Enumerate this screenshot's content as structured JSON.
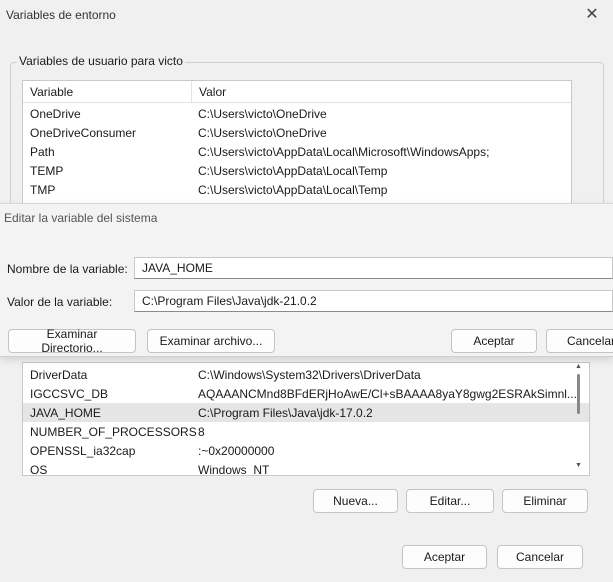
{
  "window": {
    "title": "Variables de entorno",
    "close_glyph": "✕"
  },
  "user_group": {
    "label": "Variables de usuario para victo",
    "columns": [
      "Variable",
      "Valor"
    ],
    "rows": [
      [
        "OneDrive",
        "C:\\Users\\victo\\OneDrive"
      ],
      [
        "OneDriveConsumer",
        "C:\\Users\\victo\\OneDrive"
      ],
      [
        "Path",
        "C:\\Users\\victo\\AppData\\Local\\Microsoft\\WindowsApps;"
      ],
      [
        "TEMP",
        "C:\\Users\\victo\\AppData\\Local\\Temp"
      ],
      [
        "TMP",
        "C:\\Users\\victo\\AppData\\Local\\Temp"
      ]
    ]
  },
  "system_list": {
    "rows": [
      [
        "DriverData",
        "C:\\Windows\\System32\\Drivers\\DriverData"
      ],
      [
        "IGCCSVC_DB",
        "AQAAANCMnd8BFdERjHoAwE/Cl+sBAAAA8yaY8gwg2ESRAkSimnl..."
      ],
      [
        "JAVA_HOME",
        "C:\\Program Files\\Java\\jdk-17.0.2"
      ],
      [
        "NUMBER_OF_PROCESSORS",
        "8"
      ],
      [
        "OPENSSL_ia32cap",
        ":~0x20000000"
      ],
      [
        "OS",
        "Windows_NT"
      ]
    ],
    "selected_index": 2,
    "buttons": {
      "new": "Nueva...",
      "edit": "Editar...",
      "delete": "Eliminar"
    }
  },
  "dialog": {
    "title": "Editar la variable del sistema",
    "name_label": "Nombre de la variable:",
    "name_value": "JAVA_HOME",
    "value_label": "Valor de la variable:",
    "value_value": "C:\\Program Files\\Java\\jdk-21.0.2",
    "browse_dir": "Examinar Directorio...",
    "browse_file": "Examinar archivo...",
    "accept": "Aceptar",
    "cancel": "Cancelar"
  },
  "footer": {
    "accept": "Aceptar",
    "cancel": "Cancelar"
  }
}
